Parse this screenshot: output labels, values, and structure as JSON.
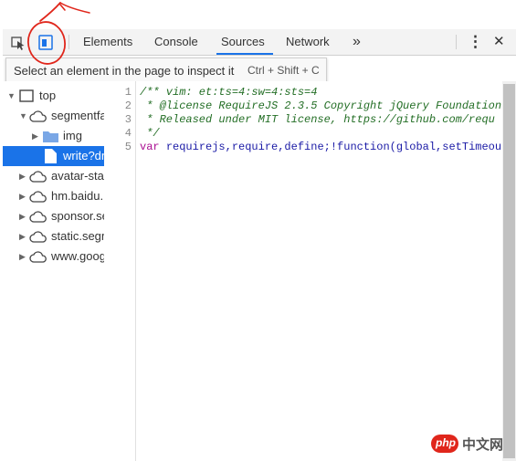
{
  "toolbar": {
    "tabs": [
      {
        "label": "Elements"
      },
      {
        "label": "Console"
      },
      {
        "label": "Sources",
        "active": true
      },
      {
        "label": "Network"
      }
    ],
    "more_tabs": "»",
    "menu_glyph": "⋮",
    "close_glyph": "✕"
  },
  "tooltip": {
    "text": "Select an element in the page to inspect it",
    "shortcut": "Ctrl + Shift + C"
  },
  "tree": [
    {
      "label": "top",
      "icon": "frame-icon",
      "expanded": true
    },
    {
      "label": "segmentfa",
      "icon": "cloud-icon",
      "expanded": true
    },
    {
      "label": "img",
      "icon": "folder-icon",
      "expanded": false
    },
    {
      "label": "write?dr",
      "icon": "file-icon",
      "selected": true
    },
    {
      "label": "avatar-sta",
      "icon": "cloud-icon",
      "expanded": false
    },
    {
      "label": "hm.baidu.",
      "icon": "cloud-icon",
      "expanded": false
    },
    {
      "label": "sponsor.se",
      "icon": "cloud-icon",
      "expanded": false
    },
    {
      "label": "static.segr",
      "icon": "cloud-icon",
      "expanded": false
    },
    {
      "label": "www.goog",
      "icon": "cloud-icon",
      "expanded": false
    }
  ],
  "editor": {
    "line_numbers": [
      "1",
      "2",
      "3",
      "4",
      "5"
    ],
    "lines": [
      "/** vim: et:ts=4:sw=4:sts=4",
      " * @license RequireJS 2.3.5 Copyright jQuery Foundation",
      " * Released under MIT license, https://github.com/requ",
      " */",
      "requirejs,require,define;!function(global,setTimeou"
    ],
    "line5_keyword": "var"
  },
  "watermark": {
    "badge": "php",
    "text": "中文网"
  },
  "colors": {
    "accent": "#1a73e8",
    "annotation": "#e0261b",
    "comment": "#236e25",
    "keyword": "#aa0d91"
  }
}
